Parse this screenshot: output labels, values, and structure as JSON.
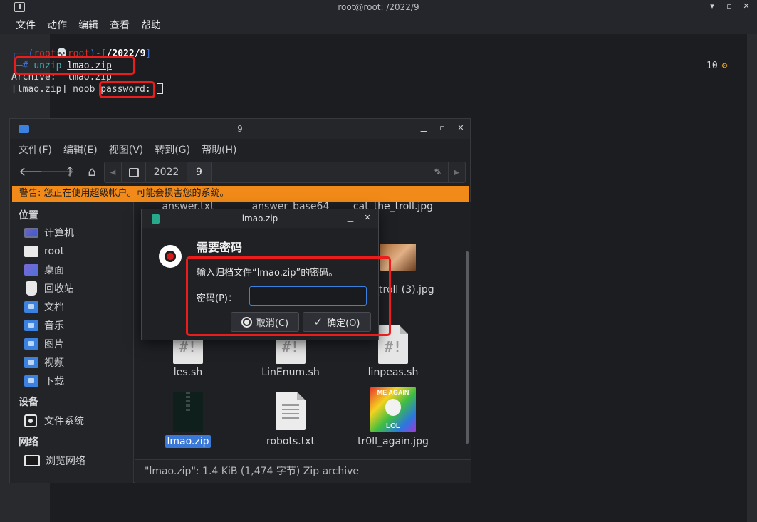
{
  "terminal": {
    "title": "root@root: /2022/9",
    "menu": [
      "文件",
      "动作",
      "编辑",
      "查看",
      "帮助"
    ],
    "prompt": {
      "open": "┌──(",
      "user": "root",
      "skull": "💀",
      "host": "root",
      "mid": ")-[",
      "path": "/2022/9",
      "close": "]",
      "arrow": "└─",
      "hash": "#",
      "command": "unzip",
      "argument": "lmao.zip"
    },
    "output_archive": "Archive:  lmao.zip",
    "output_password_prefix": "[lmao.zip] noob ",
    "output_password_label": "password:",
    "right_indicator": "10"
  },
  "filemanager": {
    "title": "9",
    "menu": [
      "文件(F)",
      "编辑(E)",
      "视图(V)",
      "转到(G)",
      "帮助(H)"
    ],
    "path": [
      "2022",
      "9"
    ],
    "warning": "警告: 您正在使用超级帐户。可能会损害您的系统。",
    "sidebar": {
      "places_heading": "位置",
      "places": [
        "计算机",
        "root",
        "桌面",
        "回收站",
        "文档",
        "音乐",
        "图片",
        "视频",
        "下载"
      ],
      "devices_heading": "设备",
      "devices": [
        "文件系统"
      ],
      "network_heading": "网络",
      "network": [
        "浏览网络"
      ]
    },
    "files_row1": [
      "answer.txt",
      "answer_base64",
      "cat_the_troll.jpg"
    ],
    "file_partial": "_troll (3).jpg",
    "files_row2": [
      "les.sh",
      "LinEnum.sh",
      "linpeas.sh"
    ],
    "files_row3": [
      "lmao.zip",
      "robots.txt",
      "tr0ll_again.jpg"
    ],
    "meme_top": "ME AGAIN",
    "meme_bottom": "LOL",
    "status": "\"lmao.zip\": 1.4 KiB (1,474 字节) Zip archive"
  },
  "dialog": {
    "title": "lmao.zip",
    "heading": "需要密码",
    "message": "输入归档文件“lmao.zip”的密码。",
    "password_label": "密码(P)：",
    "password_value": "",
    "cancel_label": "取消(C)",
    "ok_label": "确定(O)"
  },
  "colors": {
    "highlight_box": "#ea1c1c",
    "warning_bar": "#f28a1a",
    "accent_blue": "#3b82e0"
  }
}
